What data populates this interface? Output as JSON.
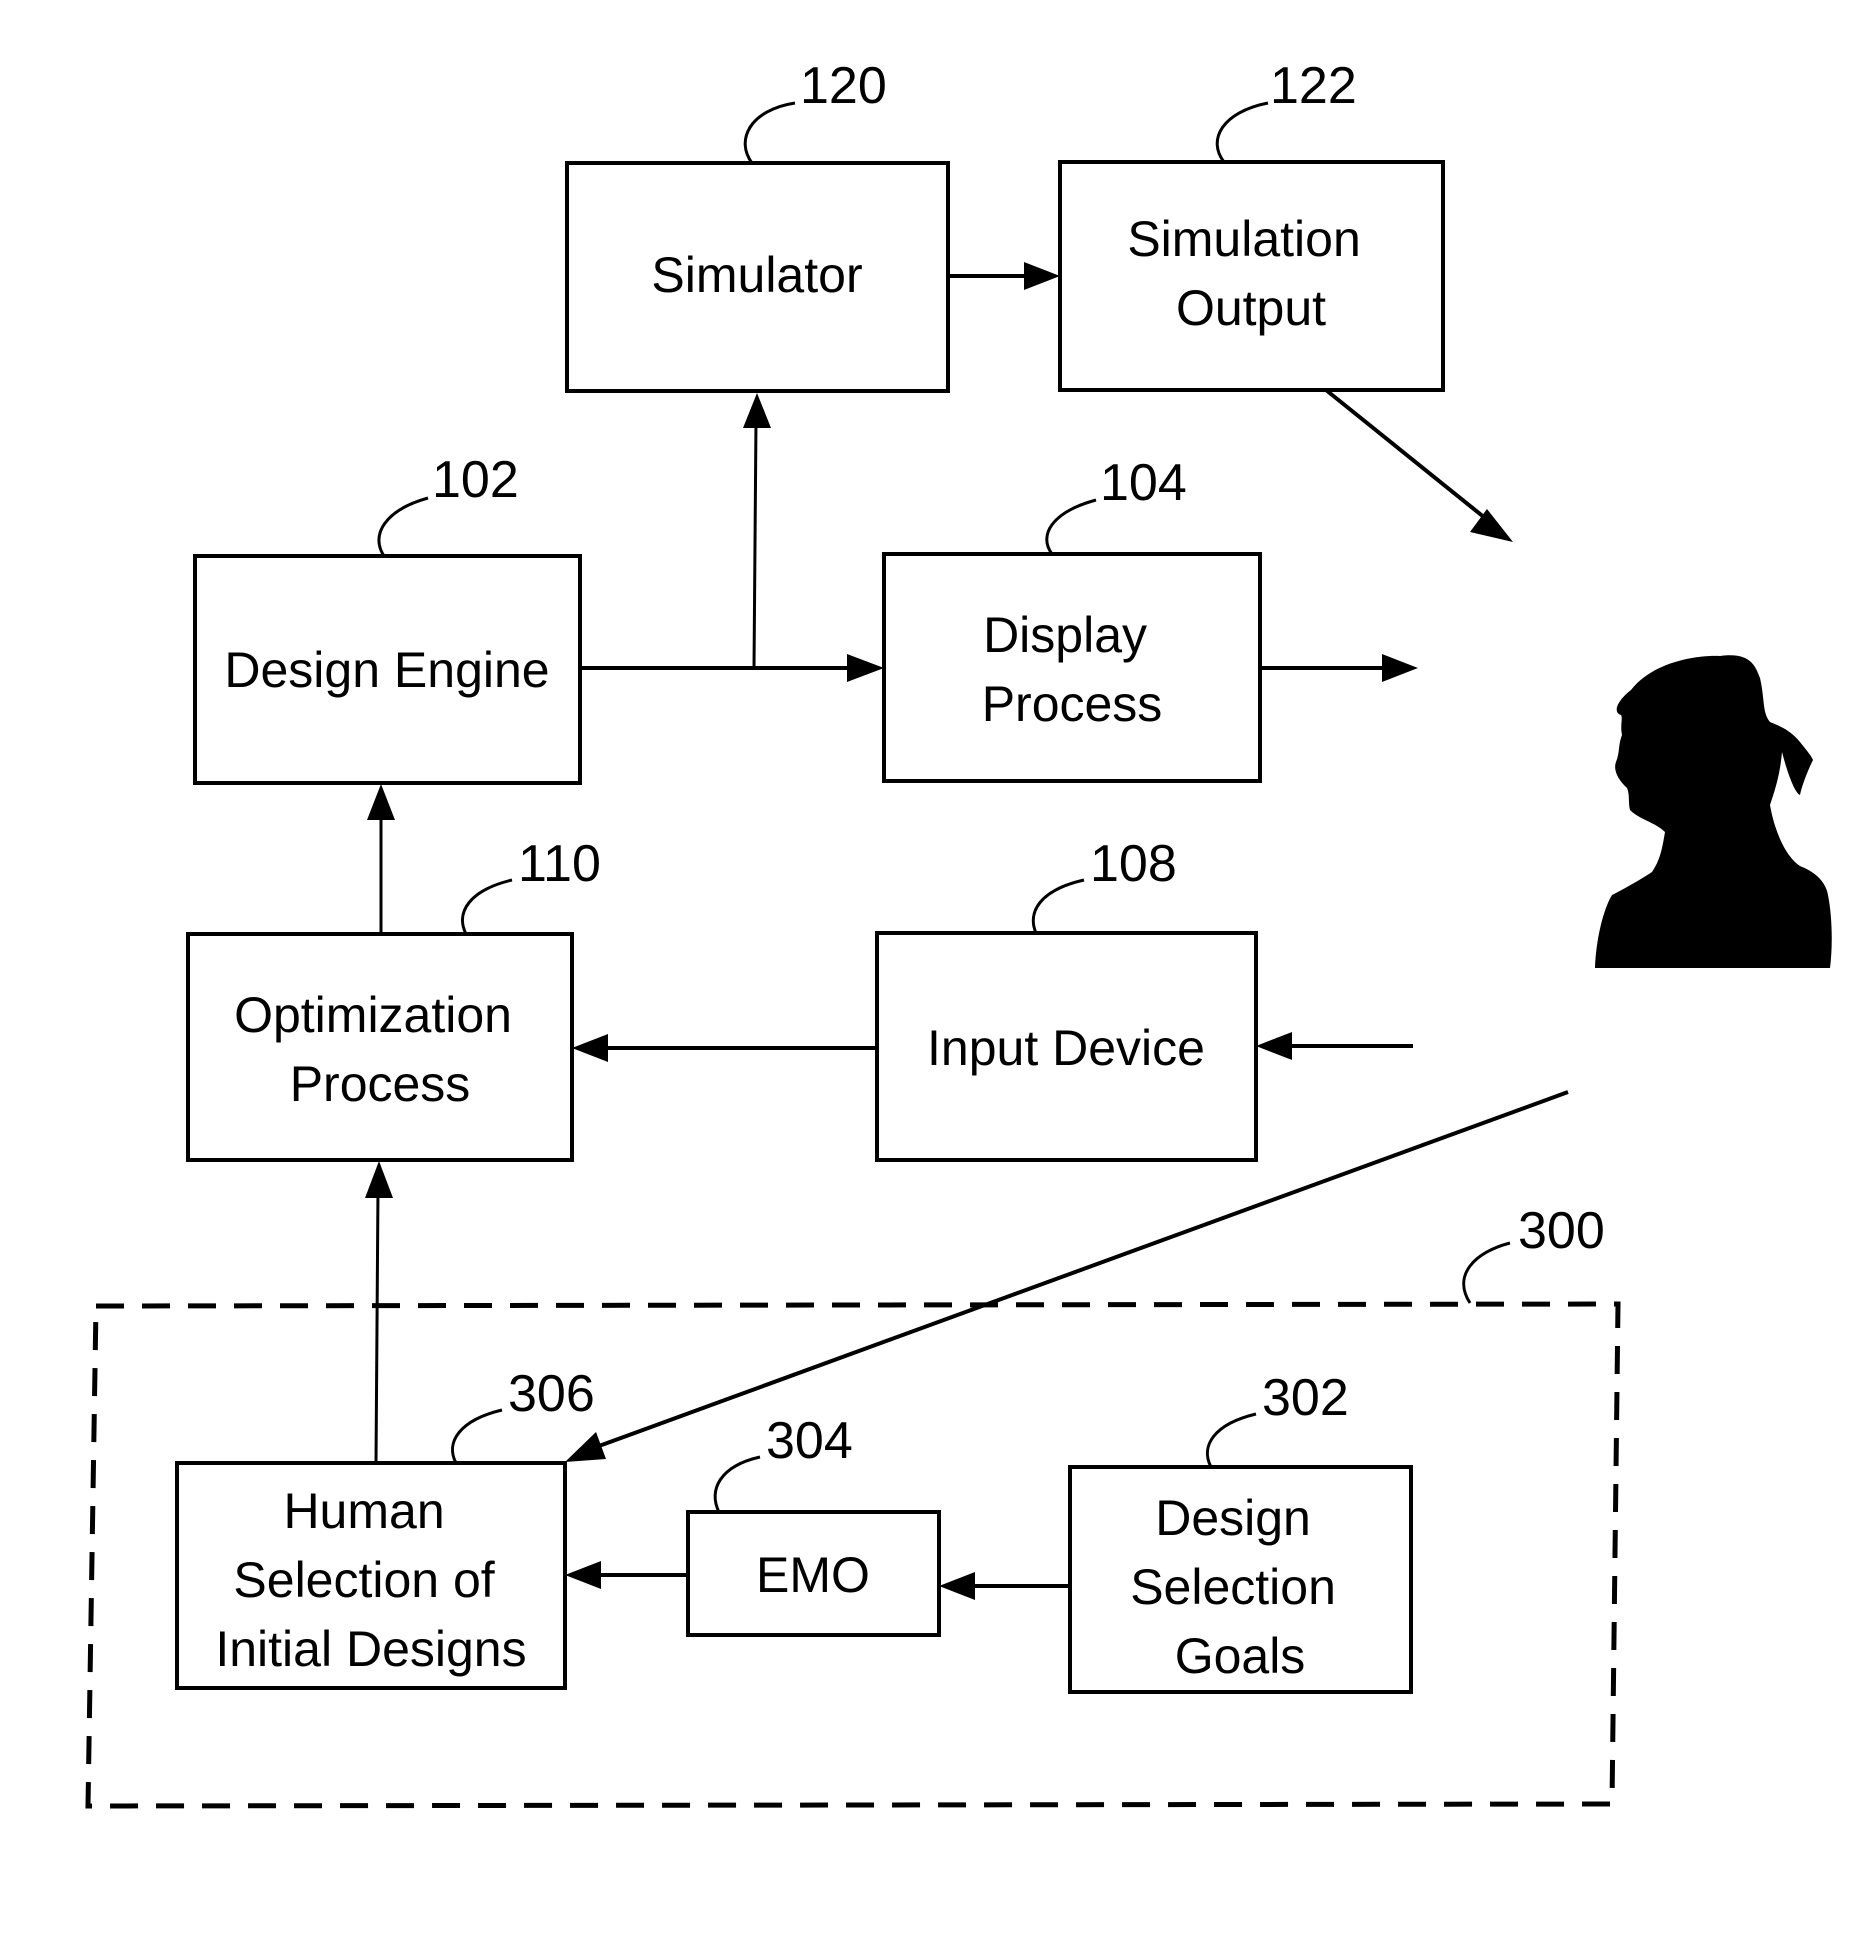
{
  "diagram": {
    "type": "block-diagram",
    "nodes": [
      {
        "id": "simulator",
        "ref": "120",
        "lines": [
          "Simulator"
        ]
      },
      {
        "id": "simulation_output",
        "ref": "122",
        "lines": [
          "Simulation",
          "Output"
        ]
      },
      {
        "id": "design_engine",
        "ref": "102",
        "lines": [
          "Design Engine"
        ]
      },
      {
        "id": "display_process",
        "ref": "104",
        "lines": [
          "Display",
          "Process"
        ]
      },
      {
        "id": "optimization_process",
        "ref": "110",
        "lines": [
          "Optimization",
          "Process"
        ]
      },
      {
        "id": "input_device",
        "ref": "108",
        "lines": [
          "Input Device"
        ]
      },
      {
        "id": "human_selection",
        "ref": "306",
        "lines": [
          "Human",
          "Selection of",
          "Initial Designs"
        ]
      },
      {
        "id": "emo",
        "ref": "304",
        "lines": [
          "EMO"
        ]
      },
      {
        "id": "design_selection_goals",
        "ref": "302",
        "lines": [
          "Design",
          "Selection",
          "Goals"
        ]
      }
    ],
    "group": {
      "id": "initialization_group",
      "ref": "300",
      "style": "dashed"
    },
    "user": {
      "icon": "person-silhouette-icon"
    },
    "edges": [
      {
        "from": "design_engine",
        "to": "display_process"
      },
      {
        "from": "design_engine",
        "to": "simulator"
      },
      {
        "from": "simulator",
        "to": "simulation_output"
      },
      {
        "from": "simulation_output",
        "to": "user"
      },
      {
        "from": "display_process",
        "to": "user"
      },
      {
        "from": "user",
        "to": "input_device"
      },
      {
        "from": "input_device",
        "to": "optimization_process"
      },
      {
        "from": "optimization_process",
        "to": "design_engine"
      },
      {
        "from": "user",
        "to": "human_selection"
      },
      {
        "from": "design_selection_goals",
        "to": "emo"
      },
      {
        "from": "emo",
        "to": "human_selection"
      },
      {
        "from": "human_selection",
        "to": "optimization_process"
      }
    ]
  }
}
